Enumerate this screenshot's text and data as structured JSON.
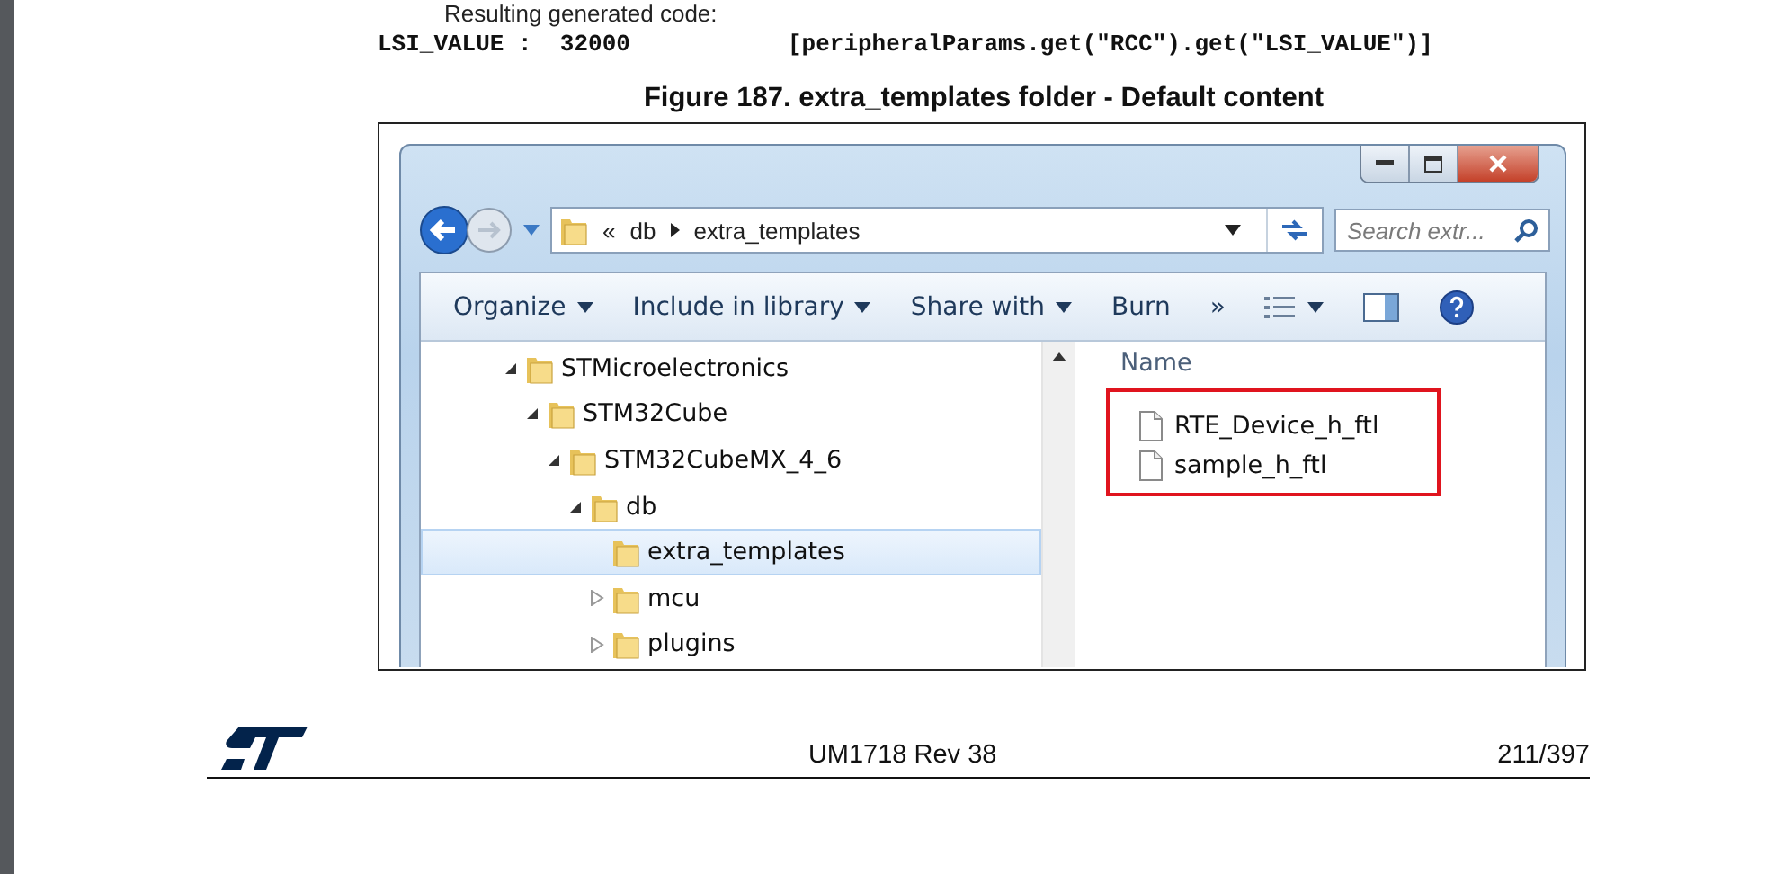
{
  "document": {
    "intro": "Resulting generated code:",
    "code": {
      "left": "LSI_VALUE :  32000",
      "right": "[peripheralParams.get(\"RCC\").get(\"LSI_VALUE\")]"
    },
    "caption": "Figure 187. extra_templates folder - Default content"
  },
  "explorer": {
    "address": {
      "overflow": "«",
      "path": [
        "db",
        "extra_templates"
      ]
    },
    "search": {
      "placeholder": "Search extr..."
    },
    "toolbar": [
      {
        "kind": "text",
        "label": "Organize",
        "dropdown": true
      },
      {
        "kind": "text",
        "label": "Include in library",
        "dropdown": true
      },
      {
        "kind": "text",
        "label": "Share with",
        "dropdown": true
      },
      {
        "kind": "text",
        "label": "Burn",
        "dropdown": false
      },
      {
        "kind": "text",
        "label": "»",
        "dropdown": false
      },
      {
        "kind": "views",
        "dropdown": true
      },
      {
        "kind": "preview",
        "dropdown": false
      },
      {
        "kind": "help",
        "dropdown": false
      }
    ],
    "tree": [
      {
        "label": "STMicroelectronics",
        "expanded": true,
        "selected": false,
        "children": [
          {
            "label": "STM32Cube",
            "expanded": true,
            "selected": false,
            "children": [
              {
                "label": "STM32CubeMX_4_6",
                "expanded": true,
                "selected": false,
                "children": [
                  {
                    "label": "db",
                    "expanded": true,
                    "selected": false,
                    "children": [
                      {
                        "label": "extra_templates",
                        "selected": true
                      },
                      {
                        "label": "mcu",
                        "expanded": false,
                        "selected": false
                      },
                      {
                        "label": "plugins",
                        "expanded": false,
                        "selected": false
                      }
                    ]
                  }
                ]
              }
            ]
          }
        ]
      }
    ],
    "column_header": "Name",
    "files_highlighted": true,
    "files": [
      {
        "name": "RTE_Device_h_ftl"
      },
      {
        "name": "sample_h_ftl"
      }
    ]
  },
  "footer": {
    "doc": "UM1718 Rev 38",
    "page": "211/397"
  }
}
